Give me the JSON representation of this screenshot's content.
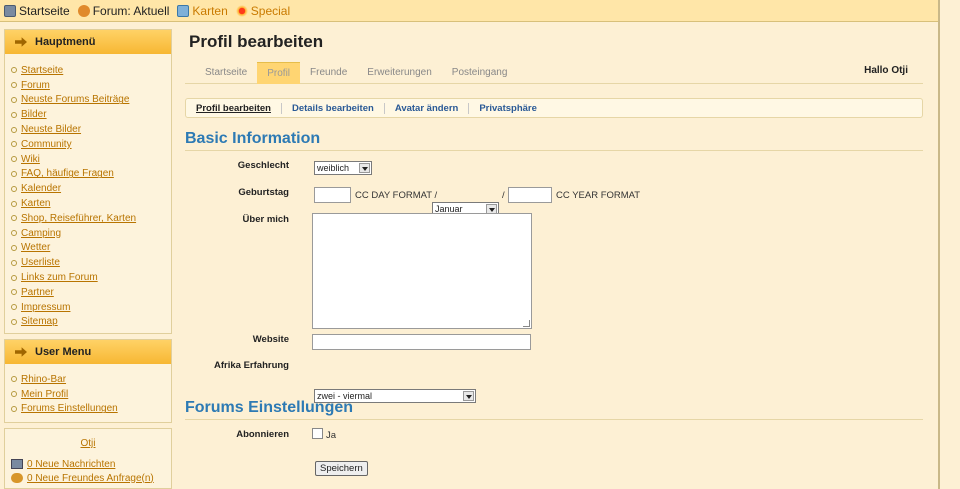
{
  "topnav": {
    "items": [
      {
        "label": "Startseite",
        "icon": "home-icon"
      },
      {
        "label": "Forum: Aktuell",
        "icon": "forum-icon"
      },
      {
        "label": "Karten",
        "icon": "map-icon"
      },
      {
        "label": "Special",
        "icon": "special-icon"
      }
    ]
  },
  "sidebar": {
    "main_menu_title": "Hauptmenü",
    "main_menu": [
      "Startseite",
      "Forum",
      "Neuste Forums Beiträge",
      "Bilder",
      "Neuste Bilder",
      "Community",
      "Wiki",
      "FAQ, häufige Fragen",
      "Kalender",
      "Karten",
      "Shop, Reiseführer, Karten",
      "Camping",
      "Wetter",
      "Userliste",
      "Links zum Forum",
      "Partner",
      "Impressum",
      "Sitemap"
    ],
    "user_menu_title": "User Menu",
    "user_menu": [
      "Rhino-Bar",
      "Mein Profil",
      "Forums Einstellungen"
    ],
    "username": "Otji",
    "messages": "0 Neue Nachrichten",
    "friend_requests": "0 Neue Freundes Anfrage(n)"
  },
  "main": {
    "title": "Profil bearbeiten",
    "tabs": [
      "Startseite",
      "Profil",
      "Freunde",
      "Erweiterungen",
      "Posteingang"
    ],
    "active_tab": "Profil",
    "greeting": "Hallo Otji",
    "subtabs": [
      "Profil bearbeiten",
      "Details bearbeiten",
      "Avatar ändern",
      "Privatsphäre"
    ]
  },
  "basic": {
    "section_title": "Basic Information",
    "gender_label": "Geschlecht",
    "gender_value": "weiblich",
    "birthday_label": "Geburtstag",
    "day_format": "CC DAY FORMAT /",
    "month_value": "Januar",
    "slash": "/",
    "year_format": "CC YEAR FORMAT",
    "about_label": "Über mich",
    "website_label": "Website",
    "africa_label": "Afrika Erfahrung",
    "africa_value": "zwei - viermal"
  },
  "forum": {
    "section_title": "Forums Einstellungen",
    "subscribe_label": "Abonnieren",
    "subscribe_option": "Ja",
    "save_label": "Speichern"
  }
}
